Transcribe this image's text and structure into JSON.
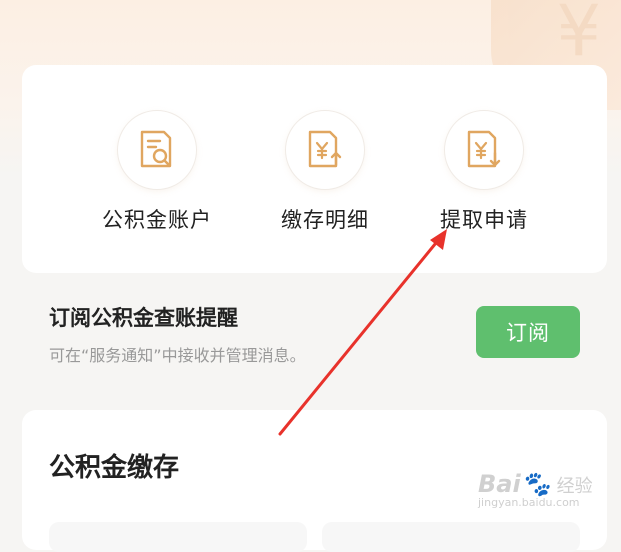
{
  "menu": {
    "items": [
      {
        "label": "公积金账户",
        "icon": "document-search-icon"
      },
      {
        "label": "缴存明细",
        "icon": "document-yuan-up-icon"
      },
      {
        "label": "提取申请",
        "icon": "document-yuan-down-icon"
      }
    ]
  },
  "subscribe": {
    "title": "订阅公积金查账提醒",
    "description": "可在“服务通知”中接收并管理消息。",
    "button_label": "订阅",
    "button_color": "#5fbf6e"
  },
  "deposit": {
    "title": "公积金缴存"
  },
  "colors": {
    "accent_icon": "#e0a660",
    "annotation_arrow": "#e8322b"
  },
  "watermark": {
    "brand": "Bai",
    "brand_suffix": "经验",
    "url": "jingyan.baidu.com"
  }
}
